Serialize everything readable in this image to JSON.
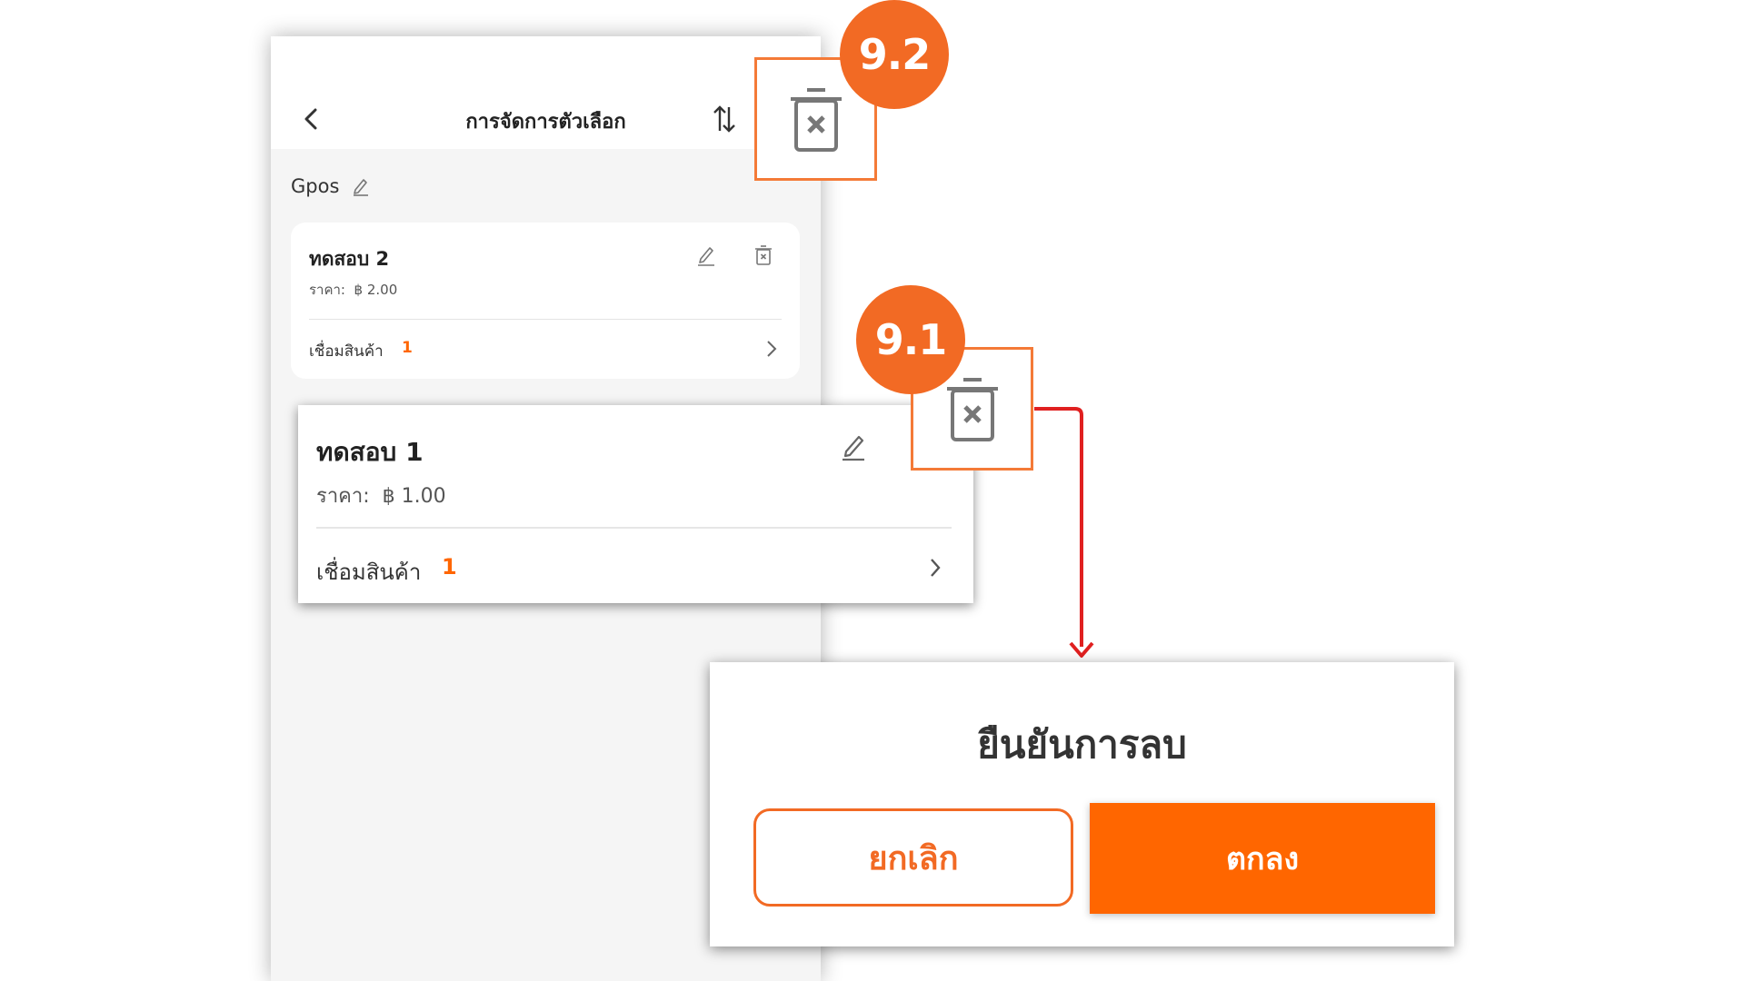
{
  "screen": {
    "title": "การจัดการตัวเลือก",
    "group_name": "Gpos"
  },
  "options": [
    {
      "name": "ทดสอบ 2",
      "price_label": "ราคา:",
      "price": "฿ 2.00",
      "link_label": "เชื่อมสินค้า",
      "link_count": "1"
    }
  ],
  "zoomed_option": {
    "name": "ทดสอบ 1",
    "price_label": "ราคา:",
    "price": "฿ 1.00",
    "link_label": "เชื่อมสินค้า",
    "link_count": "1"
  },
  "callouts": {
    "step_9_2": "9.2",
    "step_9_1": "9.1"
  },
  "dialog": {
    "title": "ยืนยันการลบ",
    "cancel_label": "ยกเลิก",
    "confirm_label": "ตกลง"
  },
  "colors": {
    "accent": "#ff6600",
    "badge": "#f26a24",
    "callout_border": "#f47a37",
    "connector": "#e02020"
  },
  "icons": [
    "back-chevron-icon",
    "sort-icon",
    "pencil-icon",
    "trash-icon",
    "chevron-right-icon"
  ]
}
